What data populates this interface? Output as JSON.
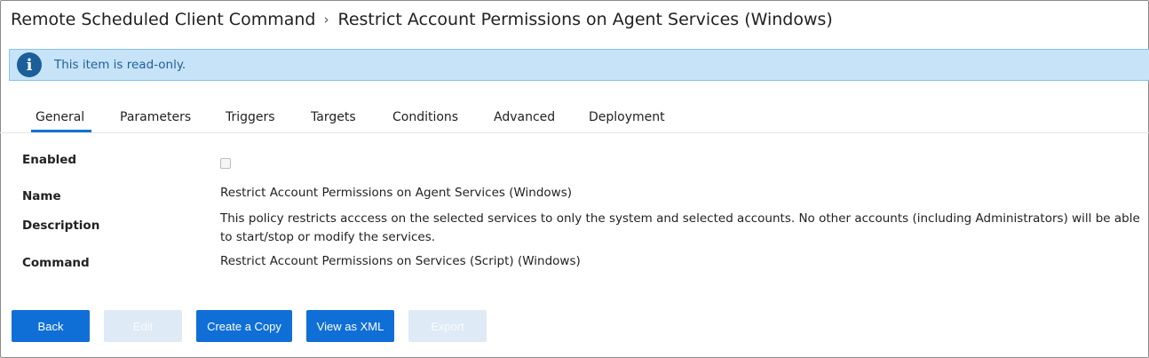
{
  "breadcrumb": {
    "parent": "Remote Scheduled Client Command",
    "separator": "›",
    "current": "Restrict Account Permissions on Agent Services (Windows)"
  },
  "banner": {
    "icon": "info-icon",
    "icon_glyph": "i",
    "text": "This item is read-only.",
    "background": "#c6e3f7",
    "text_color": "#1f5f98"
  },
  "tabs": [
    {
      "label": "General",
      "active": true
    },
    {
      "label": "Parameters",
      "active": false
    },
    {
      "label": "Triggers",
      "active": false
    },
    {
      "label": "Targets",
      "active": false
    },
    {
      "label": "Conditions",
      "active": false
    },
    {
      "label": "Advanced",
      "active": false
    },
    {
      "label": "Deployment",
      "active": false
    }
  ],
  "fields": {
    "enabled": {
      "label": "Enabled",
      "checked": false
    },
    "name": {
      "label": "Name",
      "value": "Restrict Account Permissions on Agent Services (Windows)"
    },
    "description": {
      "label": "Description",
      "value_line1": "This policy restricts acccess on the selected services to only the system and selected accounts. No other accounts (including Administrators) will be able",
      "value_line2": "to start/stop or modify the services."
    },
    "command": {
      "label": "Command",
      "value": "Restrict Account Permissions on Services (Script) (Windows)"
    }
  },
  "buttons": {
    "back": {
      "label": "Back",
      "enabled": true
    },
    "edit": {
      "label": "Edit",
      "enabled": false
    },
    "create_copy": {
      "label": "Create a Copy",
      "enabled": true
    },
    "view_xml": {
      "label": "View as XML",
      "enabled": true
    },
    "export": {
      "label": "Export",
      "enabled": false
    }
  },
  "colors": {
    "accent": "#1572cf",
    "primary_button": "#0f6fd6",
    "disabled_button": "#deeaf6"
  }
}
